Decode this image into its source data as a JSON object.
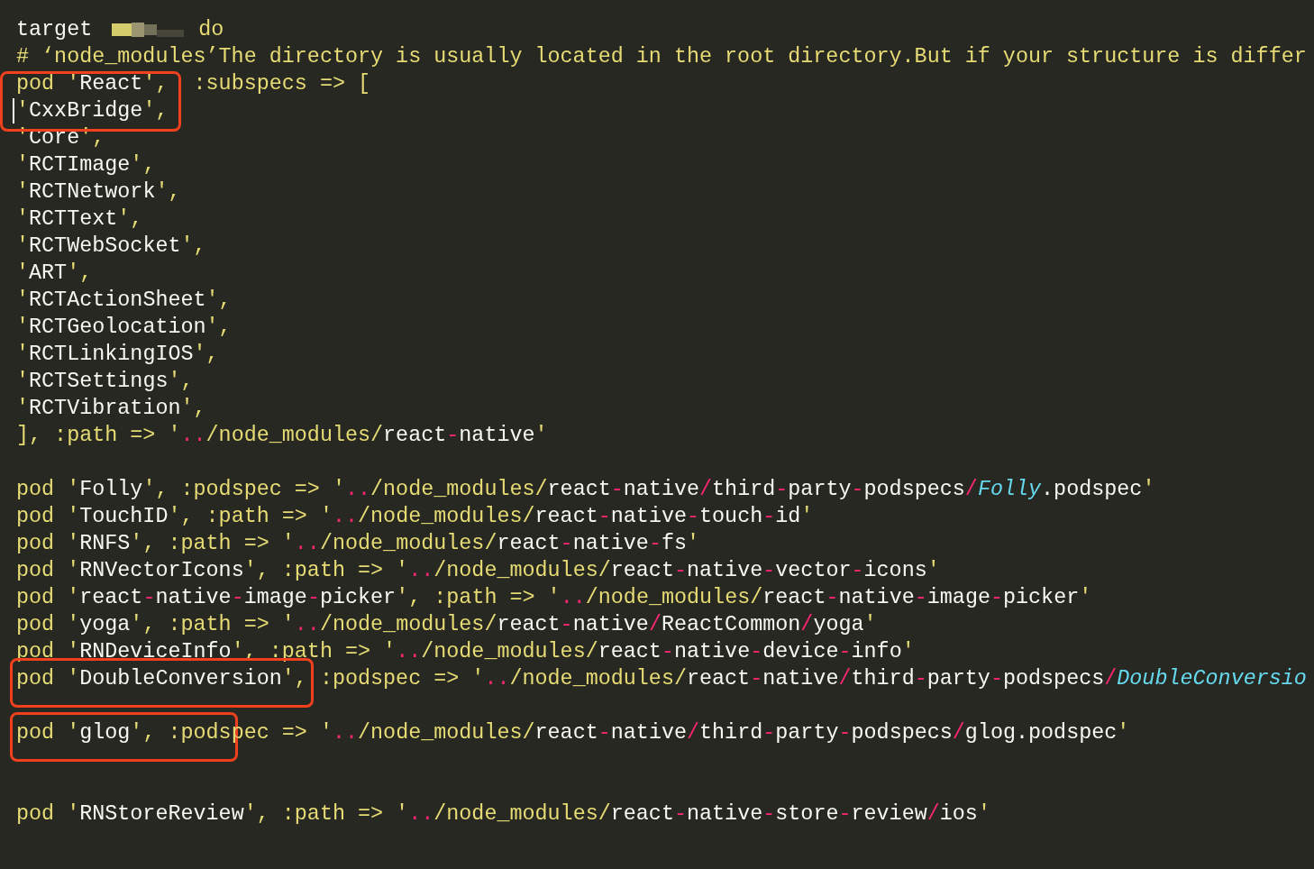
{
  "lines": [
    {
      "kind": "code",
      "tokens": [
        {
          "kind": "name",
          "text": "target"
        },
        {
          "kind": "redacted"
        },
        {
          "kind": "keyword",
          "text": " do"
        }
      ]
    },
    {
      "kind": "code",
      "tokens": [
        {
          "kind": "keyword",
          "text": "# ‘node_modules’The directory is usually located in the root directory.But if your structure is differ"
        }
      ]
    },
    {
      "kind": "code",
      "tokens": [
        {
          "kind": "keyword",
          "text": "pod '"
        },
        {
          "kind": "name",
          "text": "React"
        },
        {
          "kind": "keyword",
          "text": "',  :subspecs => ["
        }
      ]
    },
    {
      "kind": "code",
      "tokens": [
        {
          "kind": "cursor"
        },
        {
          "kind": "keyword",
          "text": "'"
        },
        {
          "kind": "name",
          "text": "CxxBridge"
        },
        {
          "kind": "keyword",
          "text": "',"
        }
      ]
    },
    {
      "kind": "code",
      "tokens": [
        {
          "kind": "keyword",
          "text": "'"
        },
        {
          "kind": "name",
          "text": "Core"
        },
        {
          "kind": "keyword",
          "text": "',"
        }
      ]
    },
    {
      "kind": "code",
      "tokens": [
        {
          "kind": "keyword",
          "text": "'"
        },
        {
          "kind": "name",
          "text": "RCTImage"
        },
        {
          "kind": "keyword",
          "text": "',"
        }
      ]
    },
    {
      "kind": "code",
      "tokens": [
        {
          "kind": "keyword",
          "text": "'"
        },
        {
          "kind": "name",
          "text": "RCTNetwork"
        },
        {
          "kind": "keyword",
          "text": "',"
        }
      ]
    },
    {
      "kind": "code",
      "tokens": [
        {
          "kind": "keyword",
          "text": "'"
        },
        {
          "kind": "name",
          "text": "RCTText"
        },
        {
          "kind": "keyword",
          "text": "',"
        }
      ]
    },
    {
      "kind": "code",
      "tokens": [
        {
          "kind": "keyword",
          "text": "'"
        },
        {
          "kind": "name",
          "text": "RCTWebSocket"
        },
        {
          "kind": "keyword",
          "text": "',"
        }
      ]
    },
    {
      "kind": "code",
      "tokens": [
        {
          "kind": "keyword",
          "text": "'"
        },
        {
          "kind": "name",
          "text": "ART"
        },
        {
          "kind": "keyword",
          "text": "',"
        }
      ]
    },
    {
      "kind": "code",
      "tokens": [
        {
          "kind": "keyword",
          "text": "'"
        },
        {
          "kind": "name",
          "text": "RCTActionSheet"
        },
        {
          "kind": "keyword",
          "text": "',"
        }
      ]
    },
    {
      "kind": "code",
      "tokens": [
        {
          "kind": "keyword",
          "text": "'"
        },
        {
          "kind": "name",
          "text": "RCTGeolocation"
        },
        {
          "kind": "keyword",
          "text": "',"
        }
      ]
    },
    {
      "kind": "code",
      "tokens": [
        {
          "kind": "keyword",
          "text": "'"
        },
        {
          "kind": "name",
          "text": "RCTLinkingIOS"
        },
        {
          "kind": "keyword",
          "text": "',"
        }
      ]
    },
    {
      "kind": "code",
      "tokens": [
        {
          "kind": "keyword",
          "text": "'"
        },
        {
          "kind": "name",
          "text": "RCTSettings"
        },
        {
          "kind": "keyword",
          "text": "',"
        }
      ]
    },
    {
      "kind": "code",
      "tokens": [
        {
          "kind": "keyword",
          "text": "'"
        },
        {
          "kind": "name",
          "text": "RCTVibration"
        },
        {
          "kind": "keyword",
          "text": "',"
        }
      ]
    },
    {
      "kind": "code",
      "tokens": [
        {
          "kind": "keyword",
          "text": "], :path => '"
        },
        {
          "kind": "operator",
          "text": ".."
        },
        {
          "kind": "keyword",
          "text": "/node_modules/"
        },
        {
          "kind": "name",
          "text": "react"
        },
        {
          "kind": "operator",
          "text": "-"
        },
        {
          "kind": "name",
          "text": "native"
        },
        {
          "kind": "keyword",
          "text": "'"
        }
      ]
    },
    {
      "kind": "blank"
    },
    {
      "kind": "code",
      "tokens": [
        {
          "kind": "keyword",
          "text": "pod '"
        },
        {
          "kind": "name",
          "text": "Folly"
        },
        {
          "kind": "keyword",
          "text": "', :podspec => '"
        },
        {
          "kind": "operator",
          "text": ".."
        },
        {
          "kind": "keyword",
          "text": "/node_modules/"
        },
        {
          "kind": "name",
          "text": "react"
        },
        {
          "kind": "operator",
          "text": "-"
        },
        {
          "kind": "name",
          "text": "native"
        },
        {
          "kind": "operator",
          "text": "/"
        },
        {
          "kind": "name",
          "text": "third"
        },
        {
          "kind": "operator",
          "text": "-"
        },
        {
          "kind": "name",
          "text": "party"
        },
        {
          "kind": "operator",
          "text": "-"
        },
        {
          "kind": "name",
          "text": "podspecs"
        },
        {
          "kind": "operator",
          "text": "/"
        },
        {
          "kind": "type",
          "text": "Folly"
        },
        {
          "kind": "name",
          "text": ".podspec"
        },
        {
          "kind": "keyword",
          "text": "'"
        }
      ]
    },
    {
      "kind": "code",
      "tokens": [
        {
          "kind": "keyword",
          "text": "pod '"
        },
        {
          "kind": "name",
          "text": "TouchID"
        },
        {
          "kind": "keyword",
          "text": "', :path => '"
        },
        {
          "kind": "operator",
          "text": ".."
        },
        {
          "kind": "keyword",
          "text": "/node_modules/"
        },
        {
          "kind": "name",
          "text": "react"
        },
        {
          "kind": "operator",
          "text": "-"
        },
        {
          "kind": "name",
          "text": "native"
        },
        {
          "kind": "operator",
          "text": "-"
        },
        {
          "kind": "name",
          "text": "touch"
        },
        {
          "kind": "operator",
          "text": "-"
        },
        {
          "kind": "name",
          "text": "id"
        },
        {
          "kind": "keyword",
          "text": "'"
        }
      ]
    },
    {
      "kind": "code",
      "tokens": [
        {
          "kind": "keyword",
          "text": "pod '"
        },
        {
          "kind": "name",
          "text": "RNFS"
        },
        {
          "kind": "keyword",
          "text": "', :path => '"
        },
        {
          "kind": "operator",
          "text": ".."
        },
        {
          "kind": "keyword",
          "text": "/node_modules/"
        },
        {
          "kind": "name",
          "text": "react"
        },
        {
          "kind": "operator",
          "text": "-"
        },
        {
          "kind": "name",
          "text": "native"
        },
        {
          "kind": "operator",
          "text": "-"
        },
        {
          "kind": "name",
          "text": "fs"
        },
        {
          "kind": "keyword",
          "text": "'"
        }
      ]
    },
    {
      "kind": "code",
      "tokens": [
        {
          "kind": "keyword",
          "text": "pod '"
        },
        {
          "kind": "name",
          "text": "RNVectorIcons"
        },
        {
          "kind": "keyword",
          "text": "', :path => '"
        },
        {
          "kind": "operator",
          "text": ".."
        },
        {
          "kind": "keyword",
          "text": "/node_modules/"
        },
        {
          "kind": "name",
          "text": "react"
        },
        {
          "kind": "operator",
          "text": "-"
        },
        {
          "kind": "name",
          "text": "native"
        },
        {
          "kind": "operator",
          "text": "-"
        },
        {
          "kind": "name",
          "text": "vector"
        },
        {
          "kind": "operator",
          "text": "-"
        },
        {
          "kind": "name",
          "text": "icons"
        },
        {
          "kind": "keyword",
          "text": "'"
        }
      ]
    },
    {
      "kind": "code",
      "tokens": [
        {
          "kind": "keyword",
          "text": "pod '"
        },
        {
          "kind": "name",
          "text": "react"
        },
        {
          "kind": "operator",
          "text": "-"
        },
        {
          "kind": "name",
          "text": "native"
        },
        {
          "kind": "operator",
          "text": "-"
        },
        {
          "kind": "name",
          "text": "image"
        },
        {
          "kind": "operator",
          "text": "-"
        },
        {
          "kind": "name",
          "text": "picker"
        },
        {
          "kind": "keyword",
          "text": "', :path => '"
        },
        {
          "kind": "operator",
          "text": ".."
        },
        {
          "kind": "keyword",
          "text": "/node_modules/"
        },
        {
          "kind": "name",
          "text": "react"
        },
        {
          "kind": "operator",
          "text": "-"
        },
        {
          "kind": "name",
          "text": "native"
        },
        {
          "kind": "operator",
          "text": "-"
        },
        {
          "kind": "name",
          "text": "image"
        },
        {
          "kind": "operator",
          "text": "-"
        },
        {
          "kind": "name",
          "text": "picker"
        },
        {
          "kind": "keyword",
          "text": "'"
        }
      ]
    },
    {
      "kind": "code",
      "tokens": [
        {
          "kind": "keyword",
          "text": "pod '"
        },
        {
          "kind": "name",
          "text": "yoga"
        },
        {
          "kind": "keyword",
          "text": "', :path => '"
        },
        {
          "kind": "operator",
          "text": ".."
        },
        {
          "kind": "keyword",
          "text": "/node_modules/"
        },
        {
          "kind": "name",
          "text": "react"
        },
        {
          "kind": "operator",
          "text": "-"
        },
        {
          "kind": "name",
          "text": "native"
        },
        {
          "kind": "operator",
          "text": "/"
        },
        {
          "kind": "name",
          "text": "ReactCommon"
        },
        {
          "kind": "operator",
          "text": "/"
        },
        {
          "kind": "name",
          "text": "yoga"
        },
        {
          "kind": "keyword",
          "text": "'"
        }
      ]
    },
    {
      "kind": "code",
      "tokens": [
        {
          "kind": "keyword",
          "text": "pod '"
        },
        {
          "kind": "name",
          "text": "RNDeviceInfo"
        },
        {
          "kind": "keyword",
          "text": "', :path => '"
        },
        {
          "kind": "operator",
          "text": ".."
        },
        {
          "kind": "keyword",
          "text": "/node_modules/"
        },
        {
          "kind": "name",
          "text": "react"
        },
        {
          "kind": "operator",
          "text": "-"
        },
        {
          "kind": "name",
          "text": "native"
        },
        {
          "kind": "operator",
          "text": "-"
        },
        {
          "kind": "name",
          "text": "device"
        },
        {
          "kind": "operator",
          "text": "-"
        },
        {
          "kind": "name",
          "text": "info"
        },
        {
          "kind": "keyword",
          "text": "'"
        }
      ]
    },
    {
      "kind": "code",
      "tokens": [
        {
          "kind": "keyword",
          "text": "pod '",
          "highlighted": true
        },
        {
          "kind": "name",
          "text": "DoubleConversion",
          "highlighted": true
        },
        {
          "kind": "keyword",
          "text": "',",
          "highlighted": true
        },
        {
          "kind": "keyword",
          "text": " :podspec => '"
        },
        {
          "kind": "operator",
          "text": ".."
        },
        {
          "kind": "keyword",
          "text": "/node_modules/"
        },
        {
          "kind": "name",
          "text": "react"
        },
        {
          "kind": "operator",
          "text": "-"
        },
        {
          "kind": "name",
          "text": "native"
        },
        {
          "kind": "operator",
          "text": "/"
        },
        {
          "kind": "name",
          "text": "third"
        },
        {
          "kind": "operator",
          "text": "-"
        },
        {
          "kind": "name",
          "text": "party"
        },
        {
          "kind": "operator",
          "text": "-"
        },
        {
          "kind": "name",
          "text": "podspecs"
        },
        {
          "kind": "operator",
          "text": "/"
        },
        {
          "kind": "type",
          "text": "DoubleConversio"
        }
      ]
    },
    {
      "kind": "blank"
    },
    {
      "kind": "code",
      "tokens": [
        {
          "kind": "keyword",
          "text": "pod '",
          "highlighted": true
        },
        {
          "kind": "name",
          "text": "glog",
          "highlighted": true
        },
        {
          "kind": "keyword",
          "text": "', :pods",
          "highlighted": true
        },
        {
          "kind": "keyword",
          "text": "pec => '"
        },
        {
          "kind": "operator",
          "text": ".."
        },
        {
          "kind": "keyword",
          "text": "/node_modules/"
        },
        {
          "kind": "name",
          "text": "react"
        },
        {
          "kind": "operator",
          "text": "-"
        },
        {
          "kind": "name",
          "text": "native"
        },
        {
          "kind": "operator",
          "text": "/"
        },
        {
          "kind": "name",
          "text": "third"
        },
        {
          "kind": "operator",
          "text": "-"
        },
        {
          "kind": "name",
          "text": "party"
        },
        {
          "kind": "operator",
          "text": "-"
        },
        {
          "kind": "name",
          "text": "podspecs"
        },
        {
          "kind": "operator",
          "text": "/"
        },
        {
          "kind": "name",
          "text": "glog.podspec"
        },
        {
          "kind": "keyword",
          "text": "'"
        }
      ]
    },
    {
      "kind": "blank"
    },
    {
      "kind": "blank"
    },
    {
      "kind": "code",
      "tokens": [
        {
          "kind": "keyword",
          "text": "pod '"
        },
        {
          "kind": "name",
          "text": "RNStoreReview"
        },
        {
          "kind": "keyword",
          "text": "', :path => '"
        },
        {
          "kind": "operator",
          "text": ".."
        },
        {
          "kind": "keyword",
          "text": "/node_modules/"
        },
        {
          "kind": "name",
          "text": "react"
        },
        {
          "kind": "operator",
          "text": "-"
        },
        {
          "kind": "name",
          "text": "native"
        },
        {
          "kind": "operator",
          "text": "-"
        },
        {
          "kind": "name",
          "text": "store"
        },
        {
          "kind": "operator",
          "text": "-"
        },
        {
          "kind": "name",
          "text": "review"
        },
        {
          "kind": "operator",
          "text": "/"
        },
        {
          "kind": "name",
          "text": "ios"
        },
        {
          "kind": "keyword",
          "text": "'"
        }
      ]
    }
  ]
}
